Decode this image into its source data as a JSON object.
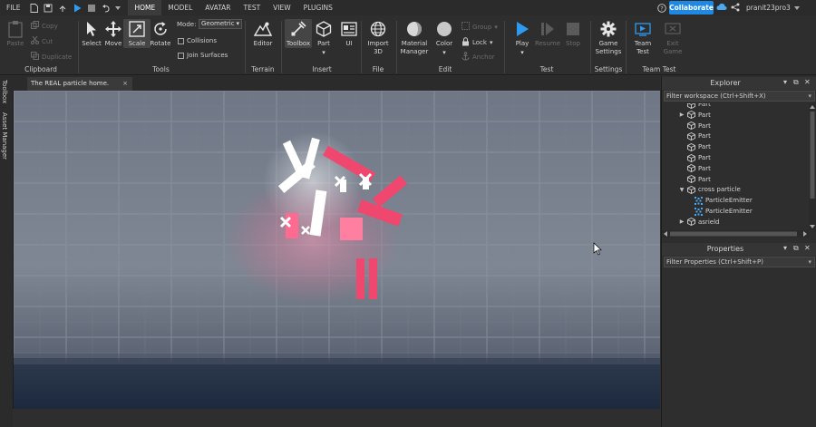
{
  "menubar": {
    "file": "FILE",
    "tabs": [
      "HOME",
      "MODEL",
      "AVATAR",
      "TEST",
      "VIEW",
      "PLUGINS"
    ],
    "collaborate": "Collaborate",
    "username": "pranit23pro3"
  },
  "ribbon": {
    "clipboard": {
      "paste": "Paste",
      "copy": "Copy",
      "cut": "Cut",
      "duplicate": "Duplicate",
      "group": "Clipboard"
    },
    "tools": {
      "select": "Select",
      "move": "Move",
      "scale": "Scale",
      "rotate": "Rotate",
      "mode_label": "Mode:",
      "mode_value": "Geometric",
      "collisions": "Collisions",
      "join_surfaces": "Join Surfaces",
      "group": "Tools"
    },
    "terrain": {
      "editor": "Editor",
      "group": "Terrain"
    },
    "insert": {
      "toolbox": "Toolbox",
      "part": "Part",
      "ui": "UI",
      "group": "Insert"
    },
    "file": {
      "import3d": "Import 3D",
      "group": "File"
    },
    "edit": {
      "material_manager": "Material Manager",
      "color": "Color",
      "group_btn": "Group",
      "lock": "Lock",
      "anchor": "Anchor",
      "group": "Edit"
    },
    "test": {
      "play": "Play",
      "resume": "Resume",
      "stop": "Stop",
      "group": "Test"
    },
    "settings": {
      "game_settings": "Game Settings",
      "group": "Settings"
    },
    "teamtest": {
      "team_test": "Team Test",
      "exit_game": "Exit Game",
      "group": "Team Test"
    }
  },
  "sidetabs": {
    "toolbox": "Toolbox",
    "asset_manager": "Asset Manager"
  },
  "doc_tab": {
    "title": "The REAL particle home.",
    "close": "×"
  },
  "explorer": {
    "title": "Explorer",
    "filter_placeholder": "Filter workspace (Ctrl+Shift+X)",
    "items": [
      {
        "label": "Part",
        "indent": 2,
        "arrow": "",
        "icon": "part-icon"
      },
      {
        "label": "Part",
        "indent": 2,
        "arrow": "▶",
        "icon": "part-icon"
      },
      {
        "label": "Part",
        "indent": 2,
        "arrow": "",
        "icon": "part-icon"
      },
      {
        "label": "Part",
        "indent": 2,
        "arrow": "",
        "icon": "part-icon"
      },
      {
        "label": "Part",
        "indent": 2,
        "arrow": "",
        "icon": "part-icon"
      },
      {
        "label": "Part",
        "indent": 2,
        "arrow": "",
        "icon": "part-icon"
      },
      {
        "label": "Part",
        "indent": 2,
        "arrow": "",
        "icon": "part-icon"
      },
      {
        "label": "Part",
        "indent": 2,
        "arrow": "",
        "icon": "part-icon"
      },
      {
        "label": "cross particle",
        "indent": 2,
        "arrow": "▼",
        "icon": "part-icon"
      },
      {
        "label": "ParticleEmitter",
        "indent": 3,
        "arrow": "",
        "icon": "particle-emitter-icon"
      },
      {
        "label": "ParticleEmitter",
        "indent": 3,
        "arrow": "",
        "icon": "particle-emitter-icon"
      },
      {
        "label": "asrield",
        "indent": 2,
        "arrow": "▶",
        "icon": "part-icon"
      }
    ]
  },
  "properties": {
    "title": "Properties",
    "filter_placeholder": "Filter Properties (Ctrl+Shift+P)"
  }
}
